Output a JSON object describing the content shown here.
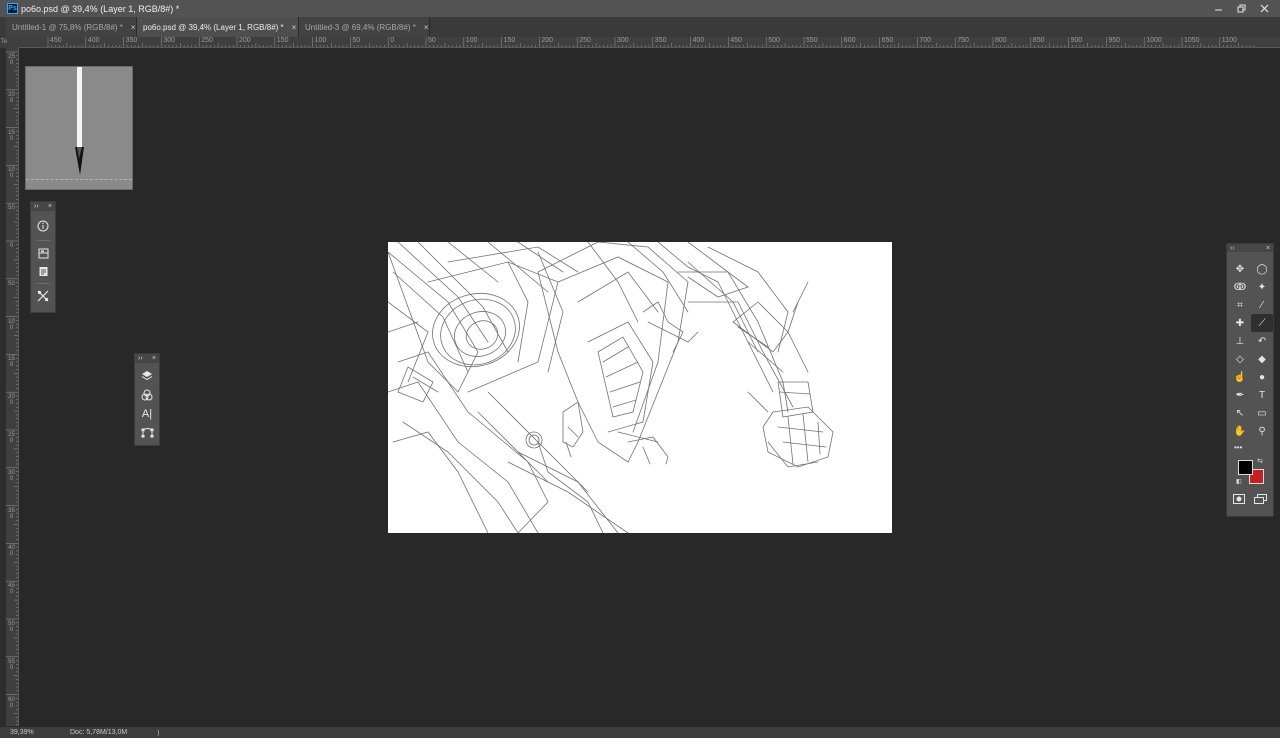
{
  "window": {
    "app_icon": "Ps",
    "title": "ро6о.psd @ 39,4% (Layer 1, RGB/8#) *",
    "controls": [
      "minimize",
      "restore",
      "close"
    ]
  },
  "tabs": [
    {
      "label": "Untitled-1 @ 75,8% (RGB/8#) *",
      "close": "×",
      "active": false
    },
    {
      "label": "ро6о.psd @ 39,4% (Layer 1, RGB/8#) *",
      "close": "×",
      "active": true
    },
    {
      "label": "Untitled-3 @ 69,4% (RGB/8#) *",
      "close": "×",
      "active": false
    }
  ],
  "ruler": {
    "corner": "Te",
    "top_labels": [
      "450",
      "400",
      "350",
      "300",
      "250",
      "200",
      "150",
      "100",
      "50",
      "0",
      "50",
      "100",
      "150",
      "200",
      "250",
      "300",
      "350",
      "400",
      "450",
      "500",
      "550",
      "600",
      "650",
      "700",
      "750",
      "800",
      "850",
      "900",
      "950",
      "1000",
      "1050",
      "1100"
    ],
    "left_labels": [
      "250",
      "200",
      "150",
      "100",
      "50",
      "0",
      "50",
      "100",
      "150",
      "200",
      "250",
      "300",
      "350",
      "400",
      "450",
      "500",
      "550",
      "600",
      "650"
    ]
  },
  "panels": {
    "properties_panel": {
      "icons": [
        "info-icon",
        "history-icon",
        "notes-icon",
        "tool-presets-icon"
      ]
    },
    "layers_panel": {
      "icons": [
        "layers-icon",
        "color-swatches-icon",
        "character-icon",
        "paths-icon"
      ]
    }
  },
  "toolbar": {
    "tools": [
      {
        "name": "move-tool",
        "glyph": "✥"
      },
      {
        "name": "elliptical-marquee-tool",
        "glyph": "◯"
      },
      {
        "name": "lasso-tool",
        "glyph": "ↂ"
      },
      {
        "name": "magic-wand-tool",
        "glyph": "✦"
      },
      {
        "name": "crop-tool",
        "glyph": "⌗"
      },
      {
        "name": "eyedropper-tool",
        "glyph": "⁄"
      },
      {
        "name": "healing-brush-tool",
        "glyph": "✚"
      },
      {
        "name": "brush-tool",
        "glyph": "⟋",
        "selected": true
      },
      {
        "name": "clone-stamp-tool",
        "glyph": "⊥"
      },
      {
        "name": "history-brush-tool",
        "glyph": "↶"
      },
      {
        "name": "eraser-tool",
        "glyph": "◇"
      },
      {
        "name": "paint-bucket-tool",
        "glyph": "◆"
      },
      {
        "name": "smudge-tool",
        "glyph": "☝"
      },
      {
        "name": "dodge-tool",
        "glyph": "●"
      },
      {
        "name": "pen-tool",
        "glyph": "✒"
      },
      {
        "name": "type-tool",
        "glyph": "T"
      },
      {
        "name": "path-selection-tool",
        "glyph": "↖"
      },
      {
        "name": "rectangle-tool",
        "glyph": "▭"
      },
      {
        "name": "hand-tool",
        "glyph": "✋"
      },
      {
        "name": "zoom-tool",
        "glyph": "⚲"
      }
    ],
    "more": "•••",
    "foreground_color": "#000000",
    "background_color": "#c42121"
  },
  "status": {
    "zoom": "39,39%",
    "doc_info": "Doc: 5,78M/13,0M",
    "arrow": "⟩"
  }
}
